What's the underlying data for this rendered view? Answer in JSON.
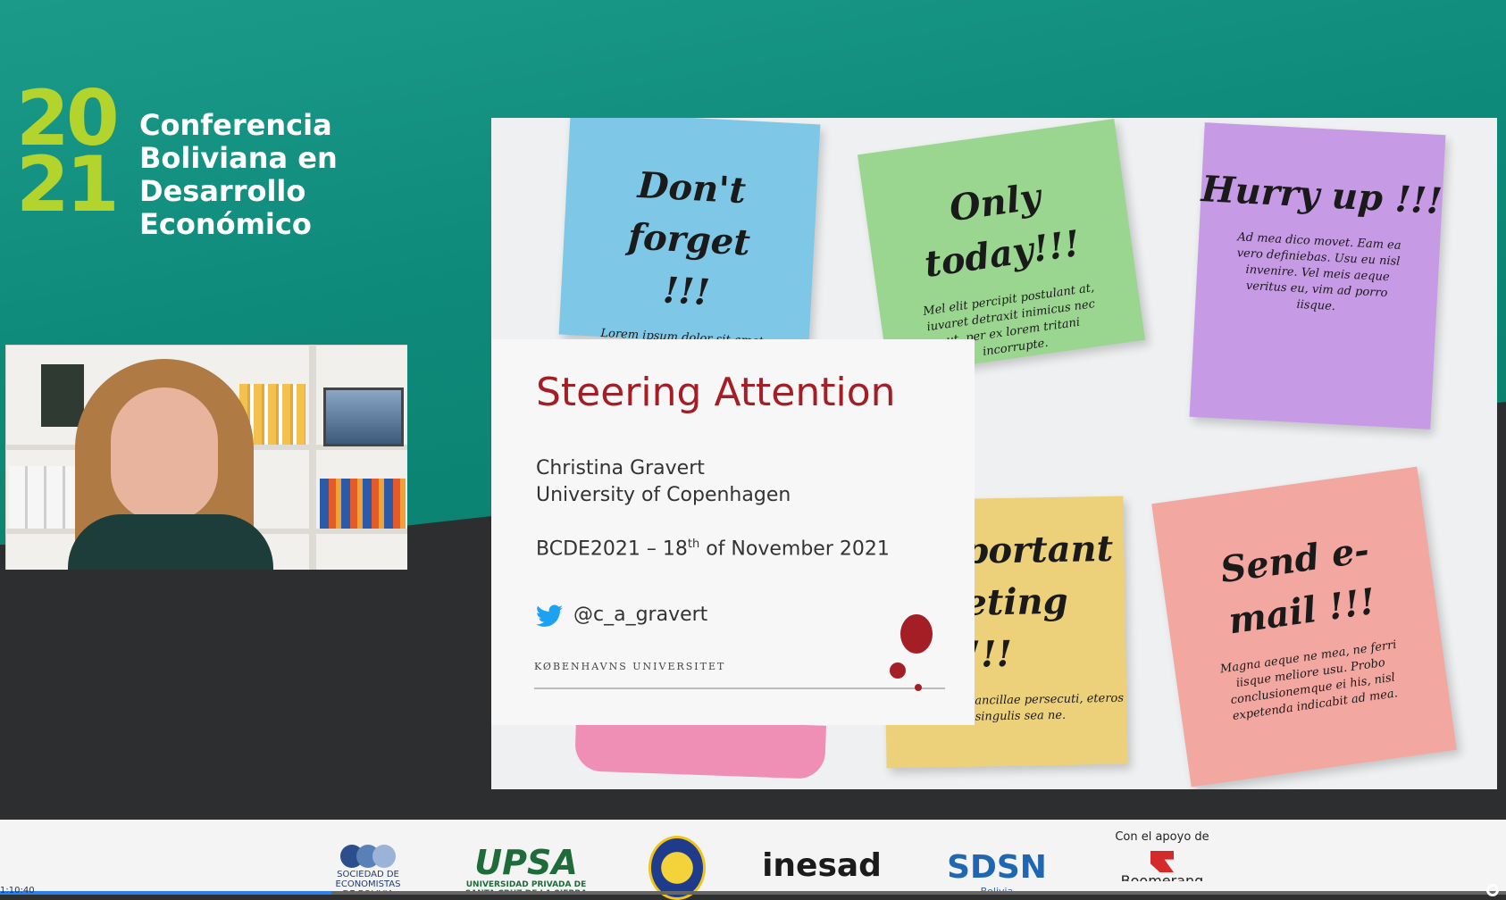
{
  "conference": {
    "year_top": "20",
    "year_bottom": "21",
    "title_lines": [
      "Conferencia",
      "Boliviana en",
      "Desarrollo",
      "Económico"
    ]
  },
  "slide": {
    "notes": [
      {
        "big": "Don't forget !!!",
        "small": "Lorem ipsum dolor sit amet, vidisse fabulas adolescens eu has. Sint probo"
      },
      {
        "big": "Only today!!!",
        "small": "Mel elit percipit postulant at, iuvaret detraxit inimicus nec ut, per ex lorem tritani incorrupte."
      },
      {
        "big": "Hurry up !!!",
        "small": "Ad mea dico movet. Eam ea vero definiebas. Usu eu nisl invenire. Vel meis aeque veritus eu, vim ad porro iisque."
      },
      {
        "big": "portant eting !!!",
        "small": "ancillae persecuti, eteros singulis sea ne."
      },
      {
        "big": "Send e-mail !!!",
        "small": "Magna aeque ne mea, ne ferri iisque meliore usu. Probo conclusionemque ei his, nisl expetenda indicabit ad mea."
      }
    ],
    "title": "Steering Attention",
    "author": "Christina Gravert",
    "affiliation": "University of Copenhagen",
    "event_prefix": "BCDE2021 – 18",
    "event_sup": "th",
    "event_suffix": " of November 2021",
    "twitter_handle": "@c_a_gravert",
    "university_label": "KØBENHAVNS UNIVERSITET"
  },
  "sponsors": {
    "sec": {
      "line1": "SOCIEDAD DE",
      "line2": "ECONOMISTAS",
      "line3": "DE BOLIVIA"
    },
    "upsa": {
      "name": "UPSA",
      "line1": "UNIVERSIDAD PRIVADA DE",
      "line2": "SANTA CRUZ DE LA SIERRA"
    },
    "inesad": {
      "name": "inesad"
    },
    "sdsn": {
      "name": "SDSN",
      "sub": "Bolivia"
    },
    "support": {
      "label": "Con el apoyo de",
      "name": "Boomerang"
    }
  },
  "player": {
    "time": "1:10:40",
    "progress": 0.22
  },
  "colors": {
    "teal": "#0f8c7c",
    "lime": "#b3d32d",
    "ku_red": "#a41e26",
    "twitter": "#1da1f2"
  }
}
